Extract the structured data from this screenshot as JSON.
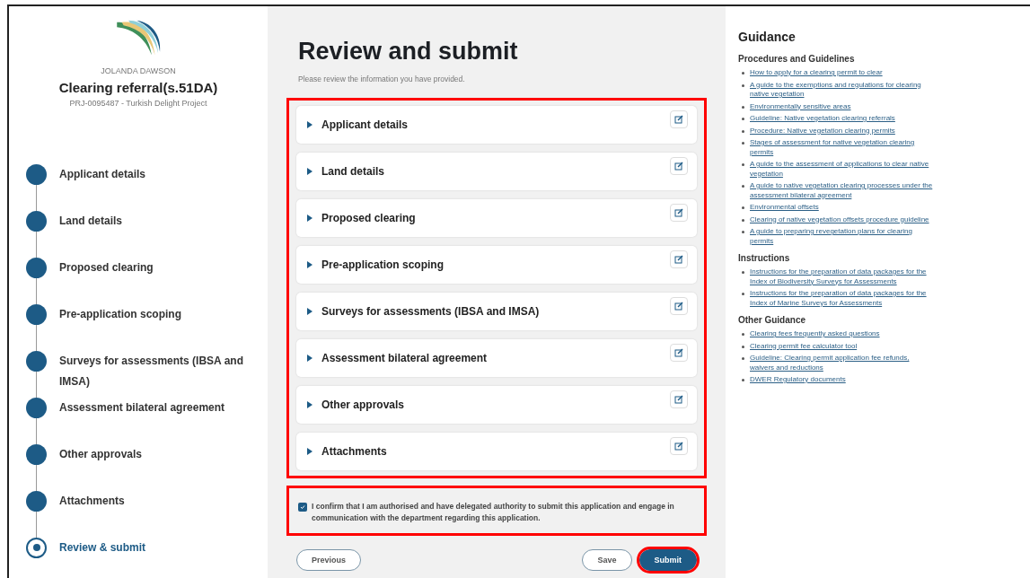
{
  "sidebar": {
    "user": "JOLANDA DAWSON",
    "title": "Clearing referral(s.51DA)",
    "project": "PRJ-0095487 - Turkish Delight Project",
    "steps": [
      {
        "label": "Applicant details",
        "selected": false
      },
      {
        "label": "Land details",
        "selected": false
      },
      {
        "label": "Proposed clearing",
        "selected": false
      },
      {
        "label": "Pre-application scoping",
        "selected": false
      },
      {
        "label": "Surveys for assessments (IBSA and IMSA)",
        "selected": false
      },
      {
        "label": "Assessment bilateral agreement",
        "selected": false
      },
      {
        "label": "Other approvals",
        "selected": false
      },
      {
        "label": "Attachments",
        "selected": false
      },
      {
        "label": "Review & submit",
        "selected": true
      }
    ]
  },
  "main": {
    "title": "Review and submit",
    "subtitle": "Please review the information you have provided.",
    "sections_highlighted": true,
    "sections": [
      {
        "label": "Applicant details",
        "expanded": false
      },
      {
        "label": "Land details",
        "expanded": false
      },
      {
        "label": "Proposed clearing",
        "expanded": false
      },
      {
        "label": "Pre-application scoping",
        "expanded": false
      },
      {
        "label": "Surveys for assessments (IBSA and IMSA)",
        "expanded": false
      },
      {
        "label": "Assessment bilateral agreement",
        "expanded": false
      },
      {
        "label": "Other approvals",
        "expanded": false
      },
      {
        "label": "Attachments",
        "expanded": false
      }
    ],
    "confirm": {
      "label": "I confirm that I am authorised and have delegated authority to submit this application and engage in communication with the department regarding this application.",
      "checked": true,
      "highlighted": true
    },
    "buttons": [
      {
        "label": "Previous",
        "kind": "outline",
        "highlighted": false
      },
      {
        "label": "Save",
        "kind": "outline",
        "highlighted": false
      },
      {
        "label": "Submit",
        "kind": "primary",
        "highlighted": true
      }
    ]
  },
  "guidance": {
    "title": "Guidance",
    "groups": [
      {
        "heading": "Procedures and Guidelines",
        "links": [
          "How to apply for a clearing permit to clear",
          "A guide to the exemptions and regulations for clearing native vegetation",
          "Environmentally sensitive areas",
          "Guideline: Native vegetation clearing referrals",
          "Procedure: Native vegetation clearing permits",
          "Stages of assessment for native vegetation clearing permits",
          "A guide to the assessment of applications to clear native vegetation",
          "A guide to native vegetation clearing processes under the assessment bilateral agreement",
          "Environmental offsets",
          "Clearing of native vegetation offsets procedure guideline",
          "A guide to preparing revegetation plans for clearing permits"
        ]
      },
      {
        "heading": "Instructions",
        "links": [
          "Instructions for the preparation of data packages for the Index of Biodiversity Surveys for Assessments",
          "Instructions for the preparation of data packages for the Index of Marine Surveys for Assessments"
        ]
      },
      {
        "heading": "Other Guidance",
        "links": [
          "Clearing fees frequently asked questions",
          "Clearing permit fee calculator tool",
          "Guideline: Clearing permit application fee refunds, waivers and reductions",
          "DWER Regulatory documents"
        ]
      }
    ]
  }
}
